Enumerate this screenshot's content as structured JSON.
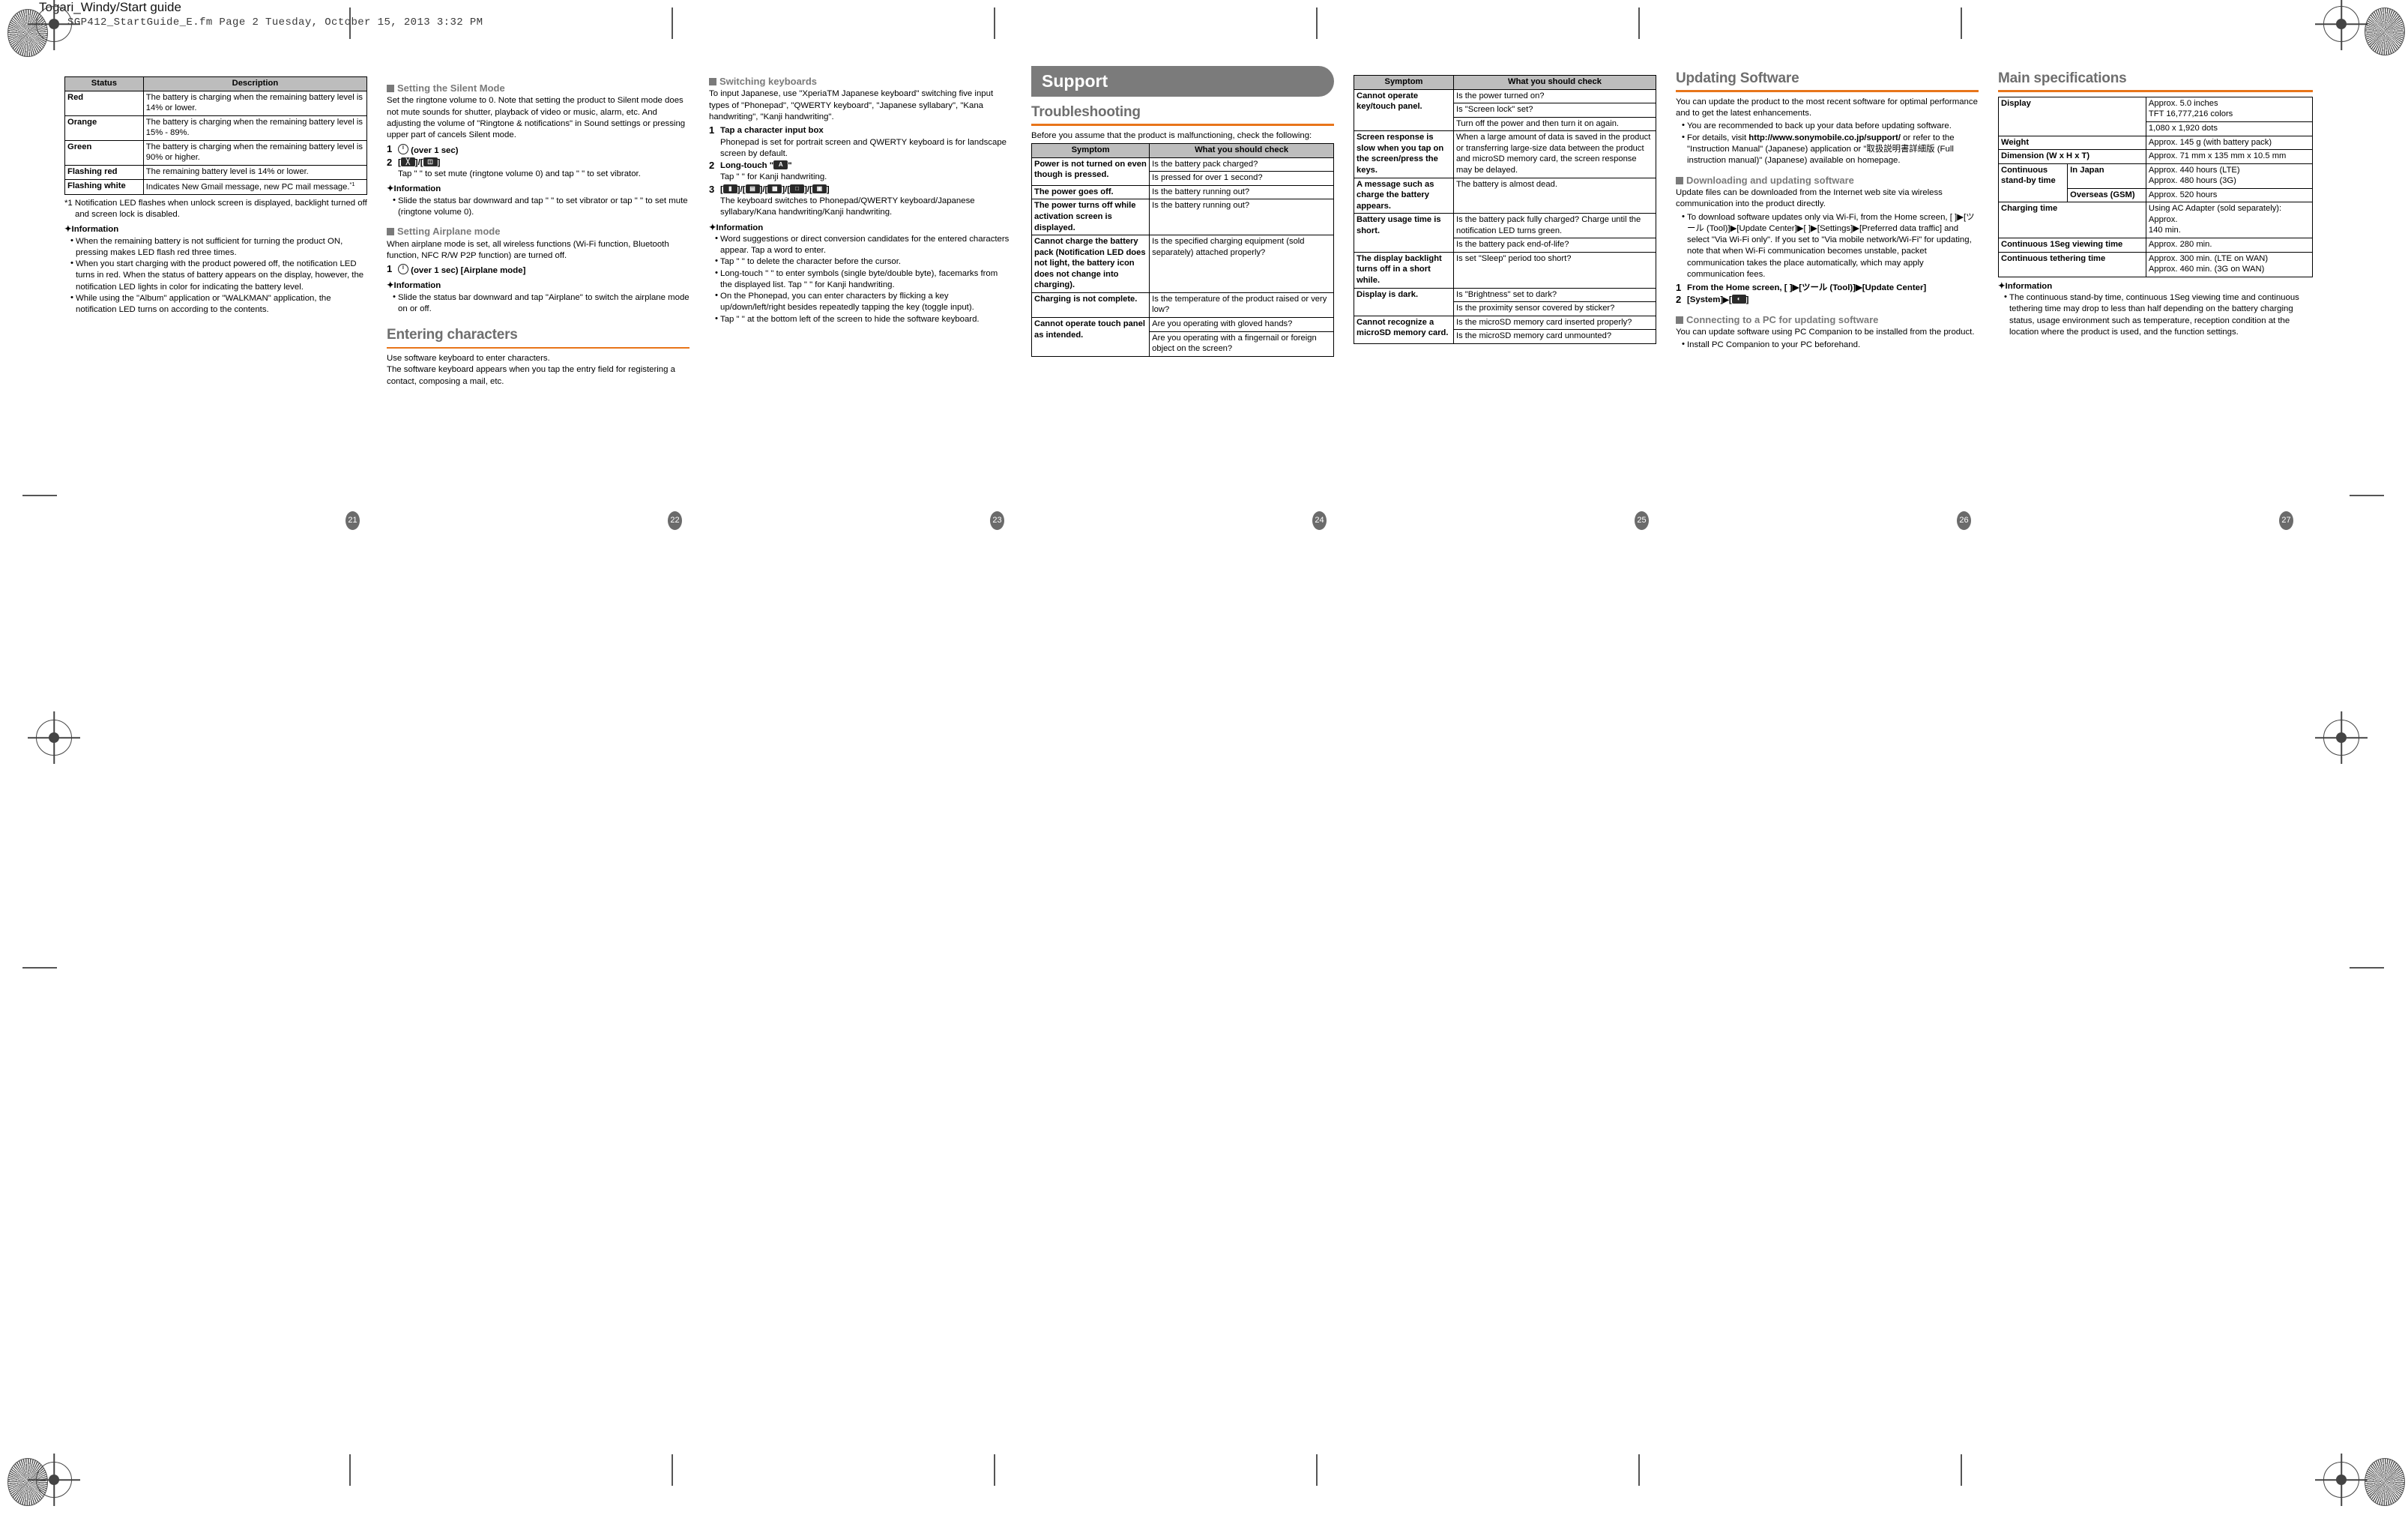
{
  "sheet": {
    "doc_title": "Togari_Windy/Start guide",
    "slug": "SGP412_StartGuide_E.fm  Page 2  Tuesday, October 15, 2013  3:32 PM",
    "page_numbers": [
      "21",
      "22",
      "23",
      "24",
      "25",
      "26",
      "27"
    ]
  },
  "page21": {
    "led_table": {
      "headers": [
        "Status",
        "Description"
      ],
      "rows": [
        [
          "Red",
          "The battery is charging when the remaining battery level is 14% or lower."
        ],
        [
          "Orange",
          "The battery is charging when the remaining battery level is 15% - 89%."
        ],
        [
          "Green",
          "The battery is charging when the remaining battery level is 90% or higher."
        ],
        [
          "Flashing red",
          "The remaining battery level is 14% or lower."
        ],
        [
          "Flashing white",
          "Indicates New Gmail message, new PC mail message."
        ]
      ],
      "footnote_marker": "*1",
      "footnote": "*1 Notification LED flashes when unlock screen is displayed, backlight turned off and screen lock is disabled."
    },
    "information_label": "Information",
    "information_items": [
      "When the remaining battery is not sufficient for turning the product ON, pressing  makes LED flash red three times.",
      "When you start charging with the product powered off, the notification LED turns in red. When the status of battery appears on the display, however, the notification LED lights in color for indicating the battery level.",
      "While using the \"Album\" application or \"WALKMAN\" application, the notification LED turns on according to the contents."
    ]
  },
  "page22": {
    "silent": {
      "heading": "Setting the Silent Mode",
      "body": "Set the ringtone volume to 0. Note that setting the product to Silent mode does not mute sounds for shutter, playback of video or music, alarm, etc. And adjusting the volume of \"Ringtone & notifications\" in Sound settings or pressing upper part of  cancels Silent mode.",
      "step1_num": "1",
      "step1_text": "(over 1 sec)",
      "step2_num": "2",
      "step2_text": "[ ]/[ ]",
      "step2_sub": "Tap \" \" to set mute (ringtone volume 0) and tap \" \" to set vibrator.",
      "information_label": "Information",
      "information_items": [
        "Slide the status bar downward and tap \" \" to set vibrator or tap \" \" to set mute (ringtone volume 0)."
      ]
    },
    "airplane": {
      "heading": "Setting Airplane mode",
      "body": "When airplane mode is set, all wireless functions (Wi-Fi function, Bluetooth function, NFC R/W P2P function) are turned off.",
      "step1_num": "1",
      "step1_text": "(over 1 sec) [Airplane mode]",
      "information_label": "Information",
      "information_items": [
        "Slide the status bar downward and tap \"Airplane\" to switch the airplane mode on or off."
      ]
    },
    "entering": {
      "heading": "Entering characters",
      "body": "Use software keyboard to enter characters.\nThe software keyboard appears when you tap the entry field for registering a contact, composing a mail, etc."
    }
  },
  "page23": {
    "switching": {
      "heading": "Switching keyboards",
      "body": "To input Japanese, use \"XperiaTM Japanese keyboard\" switching five input types of \"Phonepad\", \"QWERTY keyboard\", \"Japanese syllabary\", \"Kana handwriting\", \"Kanji handwriting\".",
      "step1_num": "1",
      "step1_text": "Tap a character input box",
      "step1_sub": "Phonepad is set for portrait screen and QWERTY keyboard is for landscape screen by default.",
      "step2_num": "2",
      "step2_text": "Long-touch \" \"",
      "step2_sub": "Tap \" \" for Kanji handwriting.",
      "step3_num": "3",
      "step3_text": "[ ]/[ ]/[ ]/[ ]/[ ]",
      "step3_sub": "The keyboard switches to Phonepad/QWERTY keyboard/Japanese syllabary/Kana handwriting/Kanji handwriting.",
      "information_label": "Information",
      "information_items": [
        "Word suggestions or direct conversion candidates for the entered characters appear. Tap a word to enter.",
        "Tap \" \" to delete the character before the cursor.",
        "Long-touch \" \" to enter symbols (single byte/double byte), facemarks from the displayed list. Tap \" \" for Kanji handwriting.",
        "On the Phonepad, you can enter characters by flicking a key up/down/left/right besides repeatedly tapping the key (toggle input).",
        "Tap \" \" at the bottom left of the screen to hide the software keyboard."
      ]
    }
  },
  "page24": {
    "banner_title": "Support",
    "section_heading": "Troubleshooting",
    "intro": "Before you assume that the product is malfunctioning, check the following:",
    "table": {
      "headers": [
        "Symptom",
        "What you should check"
      ],
      "rows": [
        {
          "symptom": "Power is not turned on even though  is pressed.",
          "checks": [
            "Is the battery pack charged?",
            "Is  pressed for over 1 second?"
          ]
        },
        {
          "symptom": "The power goes off.",
          "checks": [
            "Is the battery running out?"
          ]
        },
        {
          "symptom": "The power turns off while activation screen is displayed.",
          "checks": [
            "Is the battery running out?"
          ]
        },
        {
          "symptom": "Cannot charge the battery pack (Notification LED does not light, the battery icon does not change into charging).",
          "checks": [
            "Is the specified charging equipment (sold separately) attached properly?"
          ]
        },
        {
          "symptom": "Charging is not complete.",
          "checks": [
            "Is the temperature of the product raised or very low?"
          ]
        },
        {
          "symptom": "Cannot operate touch panel as intended.",
          "checks": [
            "Are you operating with gloved hands?",
            "Are you operating with a fingernail or foreign object on the screen?"
          ]
        }
      ]
    }
  },
  "page25": {
    "table": {
      "headers": [
        "Symptom",
        "What you should check"
      ],
      "rows": [
        {
          "symptom": "Cannot operate key/touch panel.",
          "checks": [
            "Is the power turned on?",
            "Is \"Screen lock\" set?",
            "Turn off the power and then turn it on again."
          ]
        },
        {
          "symptom": "Screen response is slow when you tap on the screen/press the keys.",
          "checks": [
            "When a large amount of data is saved in the product or transferring large-size data between the product and microSD memory card, the screen response may be delayed."
          ]
        },
        {
          "symptom": "A message such as charge the battery appears.",
          "checks": [
            "The battery is almost dead."
          ]
        },
        {
          "symptom": "Battery usage time is short.",
          "checks": [
            "Is the battery pack fully charged? Charge until the notification LED turns green.",
            "Is the battery pack end-of-life?"
          ]
        },
        {
          "symptom": "The display backlight turns off in a short while.",
          "checks": [
            "Is set \"Sleep\" period too short?"
          ]
        },
        {
          "symptom": "Display is dark.",
          "checks": [
            "Is \"Brightness\" set to dark?",
            "Is the proximity sensor covered by sticker?"
          ]
        },
        {
          "symptom": "Cannot recognize a microSD memory card.",
          "checks": [
            "Is the microSD memory card inserted properly?",
            "Is the microSD memory card unmounted?"
          ]
        }
      ]
    }
  },
  "page26": {
    "heading": "Updating Software",
    "intro": "You can update the product to the most recent software for optimal performance and to get the latest enhancements.",
    "bullets": [
      "You are recommended to back up your data before updating software.",
      "For details, visit http://www.sonymobile.co.jp/support/ or refer to the \"Instruction Manual\" (Japanese) application or \"取扱説明書詳細版 (Full instruction manual)\" (Japanese) available on homepage."
    ],
    "link_text": "http://www.sonymobile.co.jp/support/",
    "downloading": {
      "heading": "Downloading and updating software",
      "body": "Update files can be downloaded from the Internet web site via wireless communication into the product directly.",
      "bullet": "To download software updates only via Wi-Fi, from the Home screen, [ ]▶[ツール (Tool)]▶[Update Center]▶[ ]▶[Settings]▶[Preferred data traffic] and select \"Via Wi-Fi only\". If you set to \"Via mobile network/Wi-Fi\" for updating, note that when Wi-Fi communication becomes unstable, packet communication takes the place automatically, which may apply communication fees.",
      "step1_num": "1",
      "step1_text": "From the Home screen, [ ]▶[ツール (Tool)]▶[Update Center]",
      "step2_num": "2",
      "step2_text": "[System]▶[ ]"
    },
    "pc": {
      "heading": "Connecting to a PC for updating software",
      "body": "You can update software using PC Companion to be installed from the product.",
      "bullet": "Install PC Companion to your PC beforehand."
    }
  },
  "page27": {
    "heading": "Main specifications",
    "table": {
      "rows": [
        {
          "label": "Display",
          "sub": "",
          "value": "Approx. 5.0 inches\nTFT 16,777,216 colors"
        },
        {
          "label": "",
          "sub": "",
          "value": "1,080 x 1,920 dots"
        },
        {
          "label": "Weight",
          "sub": "",
          "value": "Approx. 145 g (with battery pack)"
        },
        {
          "label": "Dimension (W x H x T)",
          "sub": "",
          "value": "Approx. 71 mm x 135 mm x 10.5 mm"
        },
        {
          "label": "Continuous stand-by time",
          "sub": "In Japan",
          "value": "Approx. 440 hours (LTE)\nApprox. 480 hours (3G)"
        },
        {
          "label": "",
          "sub": "Overseas (GSM)",
          "value": "Approx. 520 hours"
        },
        {
          "label": "Charging time",
          "sub": "",
          "value": "Using AC Adapter (sold separately): Approx.\n140 min."
        },
        {
          "label": "Continuous 1Seg viewing time",
          "sub": "",
          "value": "Approx. 280 min."
        },
        {
          "label": "Continuous tethering time",
          "sub": "",
          "value": "Approx. 300 min. (LTE on WAN)\nApprox. 460 min. (3G on WAN)"
        }
      ]
    },
    "information_label": "Information",
    "information_items": [
      "The continuous stand-by time, continuous 1Seg viewing time and continuous tethering time may drop to less than half depending on the battery charging status, usage environment such as temperature, reception condition at the location where the product is used, and the function settings."
    ]
  }
}
